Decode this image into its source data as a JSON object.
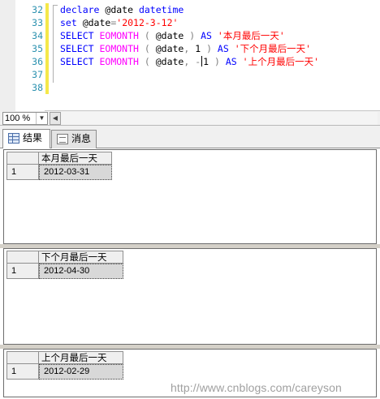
{
  "editor": {
    "line_numbers": [
      "32",
      "33",
      "34",
      "35",
      "36",
      "37",
      "38"
    ],
    "lines": [
      [
        {
          "t": "declare ",
          "c": "kw"
        },
        {
          "t": "@date ",
          "c": "ident"
        },
        {
          "t": "datetime",
          "c": "kw"
        }
      ],
      [
        {
          "t": "set ",
          "c": "kw"
        },
        {
          "t": "@date",
          "c": "ident"
        },
        {
          "t": "=",
          "c": "op"
        },
        {
          "t": "'2012-3-12'",
          "c": "str"
        }
      ],
      [
        {
          "t": "SELECT ",
          "c": "kw"
        },
        {
          "t": "EOMONTH ",
          "c": "fn"
        },
        {
          "t": "( ",
          "c": "op"
        },
        {
          "t": "@date ",
          "c": "ident"
        },
        {
          "t": ") ",
          "c": "op"
        },
        {
          "t": "AS ",
          "c": "kw"
        },
        {
          "t": "'本月最后一天'",
          "c": "str"
        }
      ],
      [
        {
          "t": "SELECT ",
          "c": "kw"
        },
        {
          "t": "EOMONTH ",
          "c": "fn"
        },
        {
          "t": "( ",
          "c": "op"
        },
        {
          "t": "@date",
          "c": "ident"
        },
        {
          "t": ", ",
          "c": "op"
        },
        {
          "t": "1 ",
          "c": "ident"
        },
        {
          "t": ") ",
          "c": "op"
        },
        {
          "t": "AS ",
          "c": "kw"
        },
        {
          "t": "'下个月最后一天'",
          "c": "str"
        }
      ],
      [
        {
          "t": "SELECT ",
          "c": "kw"
        },
        {
          "t": "EOMONTH ",
          "c": "fn"
        },
        {
          "t": "( ",
          "c": "op"
        },
        {
          "t": "@date",
          "c": "ident"
        },
        {
          "t": ", ",
          "c": "op"
        },
        {
          "t": "-",
          "c": "op"
        },
        {
          "t": "CARET",
          "c": "caret"
        },
        {
          "t": "1 ",
          "c": "ident"
        },
        {
          "t": ") ",
          "c": "op"
        },
        {
          "t": "AS ",
          "c": "kw"
        },
        {
          "t": "'上个月最后一天'",
          "c": "str"
        }
      ],
      [],
      []
    ]
  },
  "zoom": {
    "value": "100 %"
  },
  "tabs": [
    {
      "label": "结果",
      "icon": "grid-icon",
      "active": true
    },
    {
      "label": "消息",
      "icon": "messages-icon",
      "active": false
    }
  ],
  "results": [
    {
      "column": "本月最后一天",
      "row_number": "1",
      "value": "2012-03-31"
    },
    {
      "column": "下个月最后一天",
      "row_number": "1",
      "value": "2012-04-30"
    },
    {
      "column": "上个月最后一天",
      "row_number": "1",
      "value": "2012-02-29"
    }
  ],
  "watermark": "http://www.cnblogs.com/careyson",
  "colors": {
    "keyword": "#0000ff",
    "function": "#ff00ff",
    "string": "#ff0000",
    "line_number": "#2b91af"
  }
}
